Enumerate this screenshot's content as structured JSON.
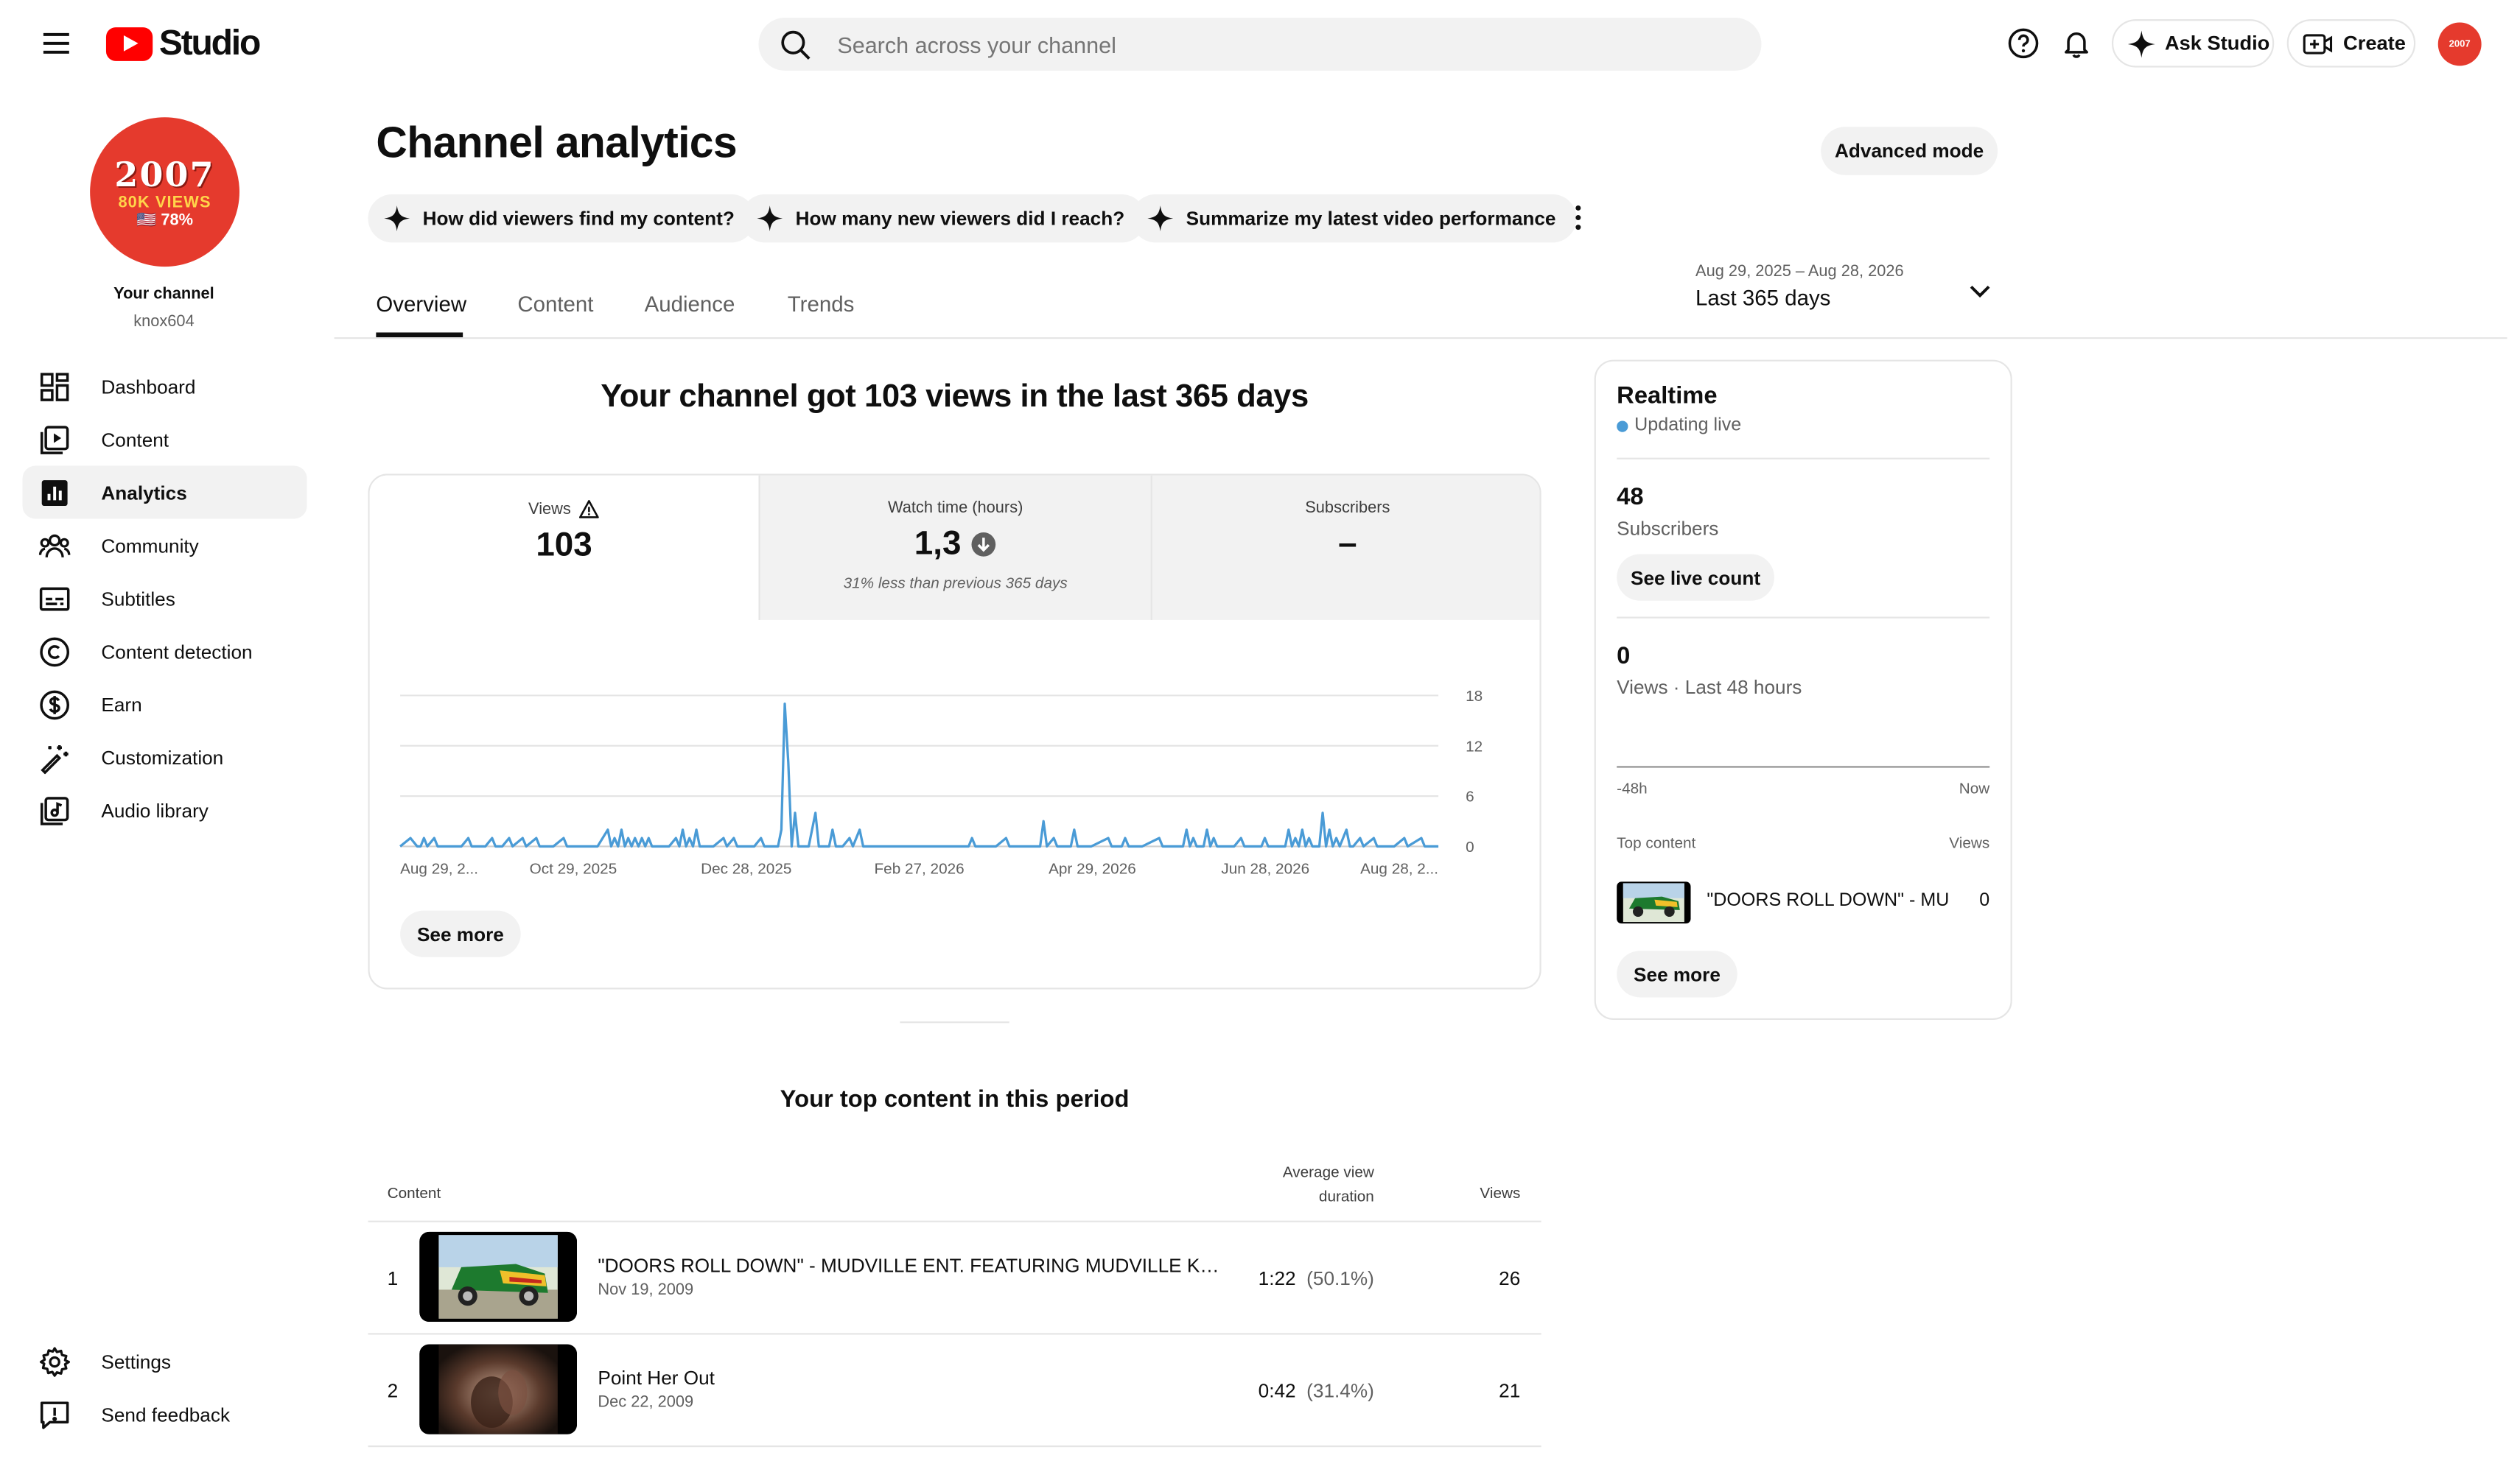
{
  "header": {
    "logo_text": "Studio",
    "search_placeholder": "Search across your channel",
    "ask_label": "Ask Studio",
    "create_label": "Create",
    "avatar_text": "2007"
  },
  "sidebar": {
    "avatar_line1": "2007",
    "avatar_line2": "80K VIEWS",
    "avatar_line3": "🇺🇸 78%",
    "channel_label": "Your channel",
    "handle": "knox604",
    "items": [
      {
        "label": "Dashboard"
      },
      {
        "label": "Content"
      },
      {
        "label": "Analytics"
      },
      {
        "label": "Community"
      },
      {
        "label": "Subtitles"
      },
      {
        "label": "Content detection"
      },
      {
        "label": "Earn"
      },
      {
        "label": "Customization"
      },
      {
        "label": "Audio library"
      }
    ],
    "bottom": [
      {
        "label": "Settings"
      },
      {
        "label": "Send feedback"
      }
    ]
  },
  "main": {
    "title": "Channel analytics",
    "advanced_mode": "Advanced mode",
    "chips": [
      "How did viewers find my content?",
      "How many new viewers did I reach?",
      "Summarize my latest video performance"
    ],
    "tabs": [
      "Overview",
      "Content",
      "Audience",
      "Trends"
    ],
    "date_range": "Aug 29, 2025 – Aug 28, 2026",
    "date_label": "Last 365 days",
    "summary_headline": "Your channel got 103 views in the last 365 days",
    "metrics": {
      "views_label": "Views",
      "views_value": "103",
      "watch_label": "Watch time (hours)",
      "watch_value": "1,3",
      "watch_note": "31% less than previous 365 days",
      "subs_label": "Subscribers",
      "subs_value": "–"
    },
    "see_more": "See more",
    "top_content": {
      "heading": "Your top content in this period",
      "col_content": "Content",
      "col_avd_1": "Average view",
      "col_avd_2": "duration",
      "col_views": "Views",
      "rows": [
        {
          "rank": "1",
          "title": "\"DOORS ROLL DOWN\" - MUDVILLE ENT. FEATURING MUDVILLE KNOX, SHU...",
          "date": "Nov 19, 2009",
          "duration": "1:22",
          "pct": "(50.1%)",
          "views": "26"
        },
        {
          "rank": "2",
          "title": "Point Her Out",
          "date": "Dec 22, 2009",
          "duration": "0:42",
          "pct": "(31.4%)",
          "views": "21"
        }
      ]
    }
  },
  "realtime": {
    "title": "Realtime",
    "live": "Updating live",
    "subs_value": "48",
    "subs_label": "Subscribers",
    "see_live": "See live count",
    "views_value": "0",
    "views_label": "Views · Last 48 hours",
    "axis_left": "-48h",
    "axis_right": "Now",
    "top_content_label": "Top content",
    "views_col": "Views",
    "top_item_title": "\"DOORS ROLL DOWN\" - MU...",
    "top_item_views": "0",
    "see_more": "See more"
  },
  "chart_data": {
    "type": "line",
    "title": "",
    "xlabel": "",
    "ylabel": "",
    "ylim": [
      0,
      18
    ],
    "yticks": [
      "18",
      "12",
      "6",
      "0"
    ],
    "xticks": [
      "Aug 29, 2...",
      "Oct 29, 2025",
      "Dec 28, 2025",
      "Feb 27, 2026",
      "Apr 29, 2026",
      "Jun 28, 2026",
      "Aug 28, 2..."
    ],
    "line_color": "#4a9bd6",
    "series": [
      {
        "name": "Views",
        "points": [
          [
            0,
            0
          ],
          [
            3,
            1
          ],
          [
            5,
            0
          ],
          [
            6,
            0
          ],
          [
            7,
            1
          ],
          [
            8,
            0
          ],
          [
            10,
            1
          ],
          [
            11,
            0
          ],
          [
            14,
            0
          ],
          [
            15,
            0
          ],
          [
            16,
            0
          ],
          [
            18,
            0
          ],
          [
            20,
            1
          ],
          [
            21,
            0
          ],
          [
            25,
            0
          ],
          [
            27,
            1
          ],
          [
            28,
            0
          ],
          [
            30,
            0
          ],
          [
            32,
            1
          ],
          [
            33,
            0
          ],
          [
            36,
            1
          ],
          [
            37,
            0
          ],
          [
            40,
            1
          ],
          [
            41,
            0
          ],
          [
            45,
            0
          ],
          [
            48,
            1
          ],
          [
            49,
            0
          ],
          [
            53,
            0
          ],
          [
            58,
            0
          ],
          [
            61,
            2
          ],
          [
            62,
            0
          ],
          [
            63,
            1
          ],
          [
            64,
            0
          ],
          [
            65,
            2
          ],
          [
            66,
            0
          ],
          [
            67,
            1
          ],
          [
            68,
            0
          ],
          [
            69,
            1
          ],
          [
            70,
            0
          ],
          [
            71,
            1
          ],
          [
            72,
            0
          ],
          [
            73,
            1
          ],
          [
            74,
            0
          ],
          [
            76,
            0
          ],
          [
            79,
            0
          ],
          [
            81,
            1
          ],
          [
            82,
            0
          ],
          [
            83,
            2
          ],
          [
            84,
            0
          ],
          [
            85,
            1
          ],
          [
            86,
            0
          ],
          [
            87,
            2
          ],
          [
            88,
            0
          ],
          [
            92,
            0
          ],
          [
            95,
            1
          ],
          [
            96,
            0
          ],
          [
            98,
            1
          ],
          [
            99,
            0
          ],
          [
            104,
            0
          ],
          [
            106,
            1
          ],
          [
            107,
            0
          ],
          [
            111,
            0
          ],
          [
            112,
            2
          ],
          [
            113,
            17
          ],
          [
            114,
            10
          ],
          [
            115,
            0
          ],
          [
            116,
            4
          ],
          [
            117,
            0
          ],
          [
            120,
            0
          ],
          [
            122,
            4
          ],
          [
            123,
            0
          ],
          [
            126,
            0
          ],
          [
            127,
            2
          ],
          [
            128,
            0
          ],
          [
            130,
            0
          ],
          [
            132,
            1
          ],
          [
            133,
            0
          ],
          [
            135,
            2
          ],
          [
            136,
            0
          ],
          [
            145,
            0
          ],
          [
            160,
            0
          ],
          [
            167,
            0
          ],
          [
            168,
            1
          ],
          [
            169,
            0
          ],
          [
            175,
            0
          ],
          [
            178,
            1
          ],
          [
            179,
            0
          ],
          [
            185,
            0
          ],
          [
            186,
            0
          ],
          [
            188,
            0
          ],
          [
            189,
            3
          ],
          [
            190,
            0
          ],
          [
            192,
            1
          ],
          [
            193,
            0
          ],
          [
            197,
            0
          ],
          [
            198,
            2
          ],
          [
            199,
            0
          ],
          [
            203,
            0
          ],
          [
            208,
            1
          ],
          [
            209,
            0
          ],
          [
            212,
            0
          ],
          [
            213,
            1
          ],
          [
            214,
            0
          ],
          [
            218,
            0
          ],
          [
            223,
            1
          ],
          [
            224,
            0
          ],
          [
            230,
            0
          ],
          [
            231,
            2
          ],
          [
            232,
            0
          ],
          [
            233,
            1
          ],
          [
            234,
            0
          ],
          [
            236,
            0
          ],
          [
            237,
            2
          ],
          [
            238,
            0
          ],
          [
            239,
            1
          ],
          [
            240,
            0
          ],
          [
            245,
            0
          ],
          [
            247,
            1
          ],
          [
            248,
            0
          ],
          [
            253,
            0
          ],
          [
            254,
            1
          ],
          [
            255,
            0
          ],
          [
            260,
            0
          ],
          [
            261,
            2
          ],
          [
            262,
            0
          ],
          [
            263,
            1
          ],
          [
            264,
            0
          ],
          [
            265,
            2
          ],
          [
            266,
            0
          ],
          [
            267,
            1
          ],
          [
            268,
            0
          ],
          [
            270,
            0
          ],
          [
            271,
            4
          ],
          [
            272,
            0
          ],
          [
            273,
            2
          ],
          [
            274,
            0
          ],
          [
            275,
            1
          ],
          [
            276,
            0
          ],
          [
            278,
            2
          ],
          [
            279,
            0
          ],
          [
            280,
            0
          ],
          [
            282,
            1
          ],
          [
            283,
            0
          ],
          [
            286,
            1
          ],
          [
            287,
            0
          ],
          [
            292,
            0
          ],
          [
            295,
            1
          ],
          [
            296,
            0
          ],
          [
            300,
            1
          ],
          [
            301,
            0
          ],
          [
            305,
            0
          ]
        ]
      }
    ],
    "x_domain": [
      0,
      305
    ]
  }
}
